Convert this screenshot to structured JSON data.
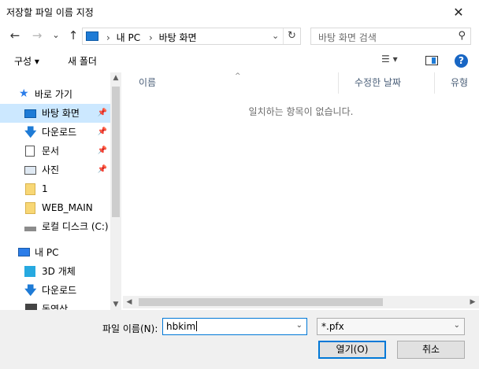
{
  "window": {
    "title": "저장할 파일 이름 지정",
    "close": "✕"
  },
  "nav_buttons": {
    "back": "←",
    "forward": "→",
    "recent": "⌄",
    "up": "↑"
  },
  "address": {
    "crumbs": [
      "내 PC",
      "바탕 화면"
    ],
    "separator": "›"
  },
  "search": {
    "placeholder": "바탕 화면 검색"
  },
  "toolbar": {
    "organize": "구성 ▾",
    "new_folder": "새 폴더",
    "view": "☰ ▾",
    "help": "?"
  },
  "sidebar": {
    "items": [
      {
        "label": "바로 가기",
        "icon": "star-icon"
      },
      {
        "label": "바탕 화면",
        "icon": "desktop-icon",
        "pinned": true,
        "selected": true
      },
      {
        "label": "다운로드",
        "icon": "download-icon",
        "pinned": true
      },
      {
        "label": "문서",
        "icon": "document-icon",
        "pinned": true
      },
      {
        "label": "사진",
        "icon": "pictures-icon",
        "pinned": true
      },
      {
        "label": "1",
        "icon": "folder-icon"
      },
      {
        "label": "WEB_MAIN",
        "icon": "folder-icon"
      },
      {
        "label": "로컬 디스크 (C:)",
        "icon": "drive-icon"
      },
      {
        "label": "내 PC",
        "icon": "pc-icon"
      },
      {
        "label": "3D 개체",
        "icon": "3d-objects-icon"
      },
      {
        "label": "다운로드",
        "icon": "download-icon"
      },
      {
        "label": "동영상",
        "icon": "video-icon"
      }
    ]
  },
  "content": {
    "columns": [
      "이름",
      "수정한 날짜",
      "유형"
    ],
    "empty_message": "일치하는 항목이 없습니다."
  },
  "footer": {
    "filename_label": "파일 이름(N):",
    "filename_value": "hbkim",
    "filetype_value": "*.pfx",
    "open_button": "열기(O)",
    "cancel_button": "취소"
  }
}
